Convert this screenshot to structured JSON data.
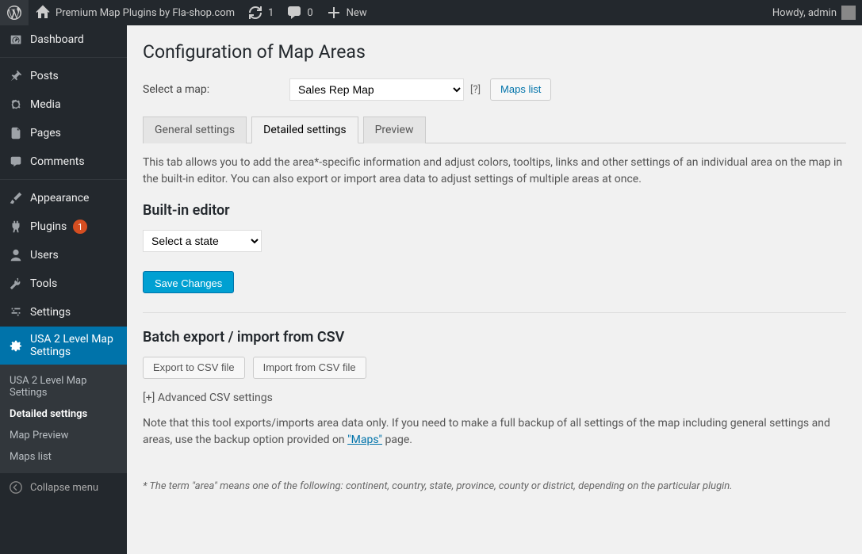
{
  "adminbar": {
    "site_title": "Premium Map Plugins by Fla-shop.com",
    "updates": "1",
    "comments": "0",
    "new": "New",
    "greeting": "Howdy, admin"
  },
  "sidebar": {
    "dashboard": "Dashboard",
    "posts": "Posts",
    "media": "Media",
    "pages": "Pages",
    "comments": "Comments",
    "appearance": "Appearance",
    "plugins": "Plugins",
    "plugins_badge": "1",
    "users": "Users",
    "tools": "Tools",
    "settings": "Settings",
    "usa_map": "USA 2 Level Map Settings",
    "sub_settings": "USA 2 Level Map Settings",
    "sub_detailed": "Detailed settings",
    "sub_preview": "Map Preview",
    "sub_maps": "Maps list",
    "collapse": "Collapse menu"
  },
  "page": {
    "title": "Configuration of Map Areas",
    "select_map_label": "Select a map:",
    "map_select_value": "Sales Rep Map",
    "help": "[?]",
    "maps_list_btn": "Maps list",
    "tabs": {
      "general": "General settings",
      "detailed": "Detailed settings",
      "preview": "Preview"
    },
    "desc": "This tab allows you to add the area*-specific information and adjust colors, tooltips, links and other settings of an individual area on the map in the built-in editor. You can also export or import area data to adjust settings of multiple areas at once.",
    "editor_heading": "Built-in editor",
    "state_select": "Select a state",
    "save_btn": "Save Changes",
    "batch_heading": "Batch export / import from CSV",
    "export_btn": "Export to CSV file",
    "import_btn": "Import from CSV file",
    "advanced_toggle": "[+]  Advanced CSV settings",
    "note_prefix": "Note that this tool exports/imports area data only. If you need to make a full backup of all settings of the map including general settings and areas, use the backup option provided on ",
    "note_link": "\"Maps\"",
    "note_suffix": " page.",
    "footnote": "* The term \"area\" means one of the following: continent, country, state, province, county or district, depending on the particular plugin."
  }
}
